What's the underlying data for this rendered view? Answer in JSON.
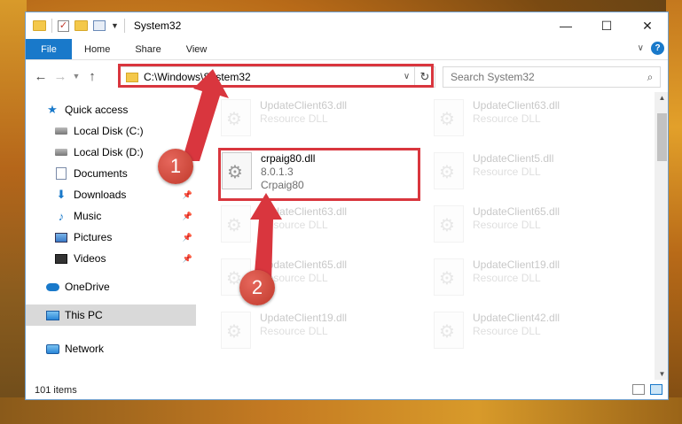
{
  "window": {
    "title": "System32"
  },
  "ribbon": {
    "tabs": [
      "File",
      "Home",
      "Share",
      "View"
    ],
    "help": "?"
  },
  "address": {
    "path": "C:\\Windows\\System32"
  },
  "search": {
    "placeholder": "Search System32"
  },
  "sidebar": {
    "items": [
      {
        "label": "Quick access",
        "icon": "star-icon"
      },
      {
        "label": "Local Disk (C:)",
        "icon": "drive-icon"
      },
      {
        "label": "Local Disk (D:)",
        "icon": "drive-icon"
      },
      {
        "label": "Documents",
        "icon": "documents-icon"
      },
      {
        "label": "Downloads",
        "icon": "download-icon"
      },
      {
        "label": "Music",
        "icon": "music-icon"
      },
      {
        "label": "Pictures",
        "icon": "pictures-icon"
      },
      {
        "label": "Videos",
        "icon": "videos-icon"
      },
      {
        "label": "OneDrive",
        "icon": "cloud-icon"
      },
      {
        "label": "This PC",
        "icon": "computer-icon"
      },
      {
        "label": "Network",
        "icon": "network-icon"
      }
    ]
  },
  "files": {
    "highlighted": {
      "name": "crpaig80.dll",
      "version": "8.0.1.3",
      "description": "Crpaig80"
    },
    "faded": [
      {
        "name": "UpdateClient63.dll",
        "type": "Resource DLL"
      },
      {
        "name": "UpdateClient63.dll",
        "type": "Resource DLL"
      },
      {
        "name": "UpdateClient5.dll",
        "type": "Resource DLL"
      },
      {
        "name": "UpdateClient63.dll",
        "type": "Resource DLL"
      },
      {
        "name": "UpdateClient65.dll",
        "type": "Resource DLL"
      },
      {
        "name": "UpdateClient65.dll",
        "type": "Resource DLL"
      },
      {
        "name": "UpdateClient19.dll",
        "type": "Resource DLL"
      },
      {
        "name": "UpdateClient19.dll",
        "type": "Resource DLL"
      },
      {
        "name": "UpdateClient42.dll",
        "type": "Resource DLL"
      }
    ]
  },
  "status": {
    "count": "101 items"
  },
  "annotations": {
    "step1": "1",
    "step2": "2"
  },
  "colors": {
    "accent": "#1979ca",
    "highlight": "#d9363e"
  }
}
